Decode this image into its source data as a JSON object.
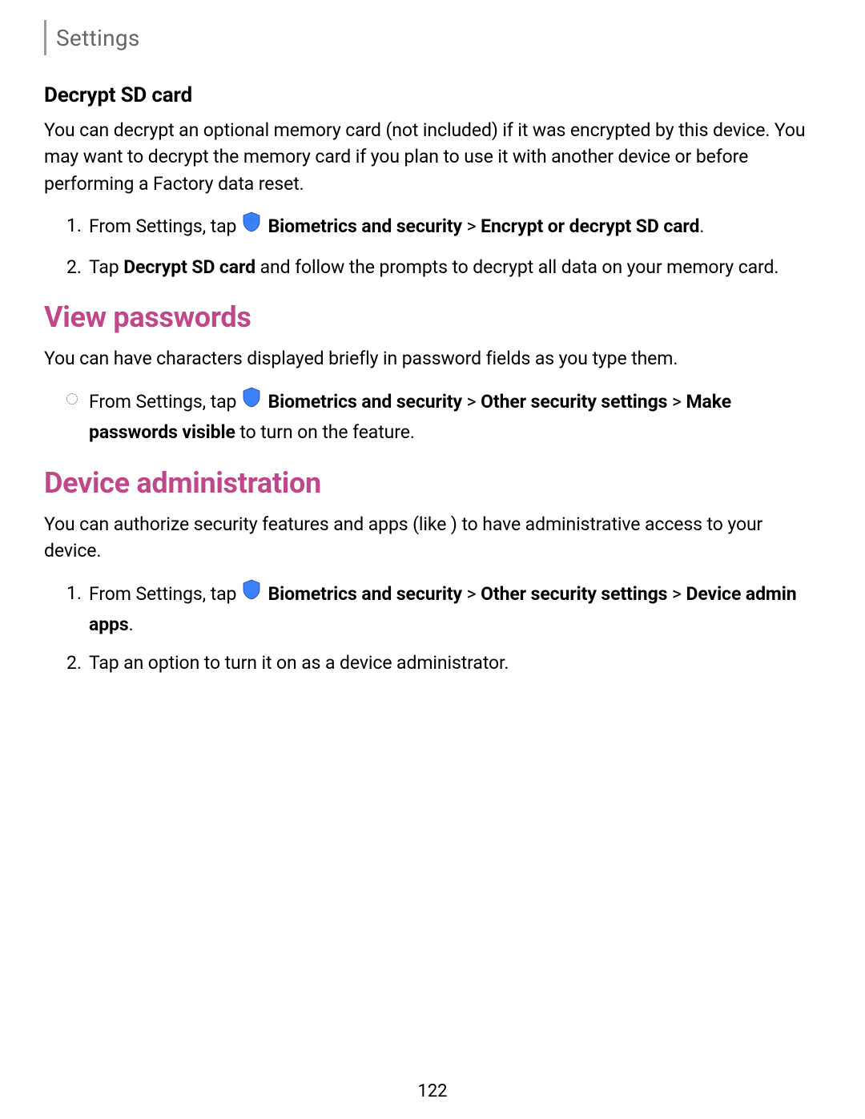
{
  "header": {
    "title": "Settings"
  },
  "section1": {
    "heading": "Decrypt SD card",
    "intro": "You can decrypt an optional memory card (not included) if it was encrypted by this device. You may want to decrypt the memory card if you plan to use it with another device or before performing a Factory data reset.",
    "step1_pre": "From Settings, tap ",
    "step1_bold1": "Biometrics and security",
    "step1_sep": " > ",
    "step1_bold2": "Encrypt or decrypt SD card",
    "step1_end": ".",
    "step2_pre": "Tap ",
    "step2_bold": "Decrypt SD card",
    "step2_rest": " and follow the prompts to decrypt all data on your memory card."
  },
  "section2": {
    "heading": "View passwords",
    "intro": "You can have characters displayed briefly in password fields as you type them.",
    "bullet_pre": "From Settings, tap ",
    "bullet_bold1": "Biometrics and security",
    "bullet_sep1": " > ",
    "bullet_bold2": "Other security settings",
    "bullet_sep2": " > ",
    "bullet_bold3": "Make passwords visible",
    "bullet_rest": " to turn on the feature."
  },
  "section3": {
    "heading": "Device administration",
    "intro": "You can authorize security features and apps (like ) to have administrative access to your device.",
    "step1_pre": "From Settings, tap ",
    "step1_bold1": "Biometrics and security",
    "step1_sep1": " > ",
    "step1_bold2": "Other security settings",
    "step1_sep2": " > ",
    "step1_bold3": "Device admin apps",
    "step1_end": ".",
    "step2": "Tap an option to turn it on as a device administrator."
  },
  "page_number": "122"
}
